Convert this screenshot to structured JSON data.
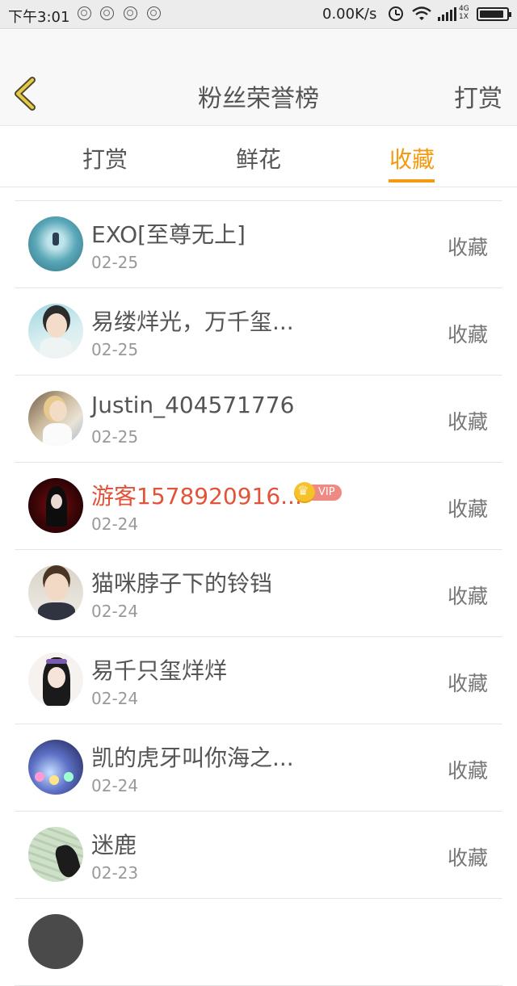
{
  "status_bar": {
    "time": "下午3:01",
    "net_speed": "0.00K/s",
    "network_type": "4G\n1X",
    "battery_level": 0.9
  },
  "header": {
    "back_icon": "chevron-left-icon",
    "title": "粉丝荣誉榜",
    "action_label": "打赏"
  },
  "tabs": [
    {
      "label": "打赏",
      "active": false
    },
    {
      "label": "鲜花",
      "active": false
    },
    {
      "label": "收藏",
      "active": true
    }
  ],
  "accent_color": "#f39a10",
  "vip_badge_label": "VIP",
  "rows": [
    {
      "name": "EXO[至尊无上]",
      "date": "02-25",
      "action": "收藏",
      "vip": false
    },
    {
      "name": "易缕烊光，万千玺...",
      "date": "02-25",
      "action": "收藏",
      "vip": false
    },
    {
      "name": "Justin_404571776",
      "date": "02-25",
      "action": "收藏",
      "vip": false
    },
    {
      "name": "游客1578920916...",
      "date": "02-24",
      "action": "收藏",
      "vip": true
    },
    {
      "name": "猫咪脖子下的铃铛",
      "date": "02-24",
      "action": "收藏",
      "vip": false
    },
    {
      "name": "易千只玺烊烊",
      "date": "02-24",
      "action": "收藏",
      "vip": false
    },
    {
      "name": "凯的虎牙叫你海之...",
      "date": "02-24",
      "action": "收藏",
      "vip": false
    },
    {
      "name": "迷鹿",
      "date": "02-23",
      "action": "收藏",
      "vip": false
    },
    {
      "name": "",
      "date": "",
      "action": "",
      "vip": false
    }
  ]
}
